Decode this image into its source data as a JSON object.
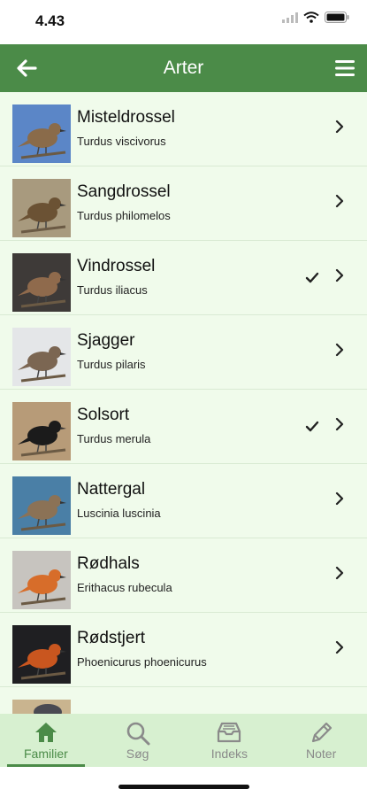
{
  "status": {
    "time": "4.43"
  },
  "header": {
    "title": "Arter"
  },
  "species": [
    {
      "name": "Misteldrossel",
      "latin": "Turdus viscivorus",
      "checked": false,
      "thumb_colors": [
        "#5b86c7",
        "#8a6b4a"
      ]
    },
    {
      "name": "Sangdrossel",
      "latin": "Turdus philomelos",
      "checked": false,
      "thumb_colors": [
        "#a89a7e",
        "#6b5234"
      ]
    },
    {
      "name": "Vindrossel",
      "latin": "Turdus iliacus",
      "checked": true,
      "thumb_colors": [
        "#3e3a38",
        "#8f6a4c"
      ]
    },
    {
      "name": "Sjagger",
      "latin": "Turdus pilaris",
      "checked": false,
      "thumb_colors": [
        "#e4e6e8",
        "#7b6652"
      ]
    },
    {
      "name": "Solsort",
      "latin": "Turdus merula",
      "checked": true,
      "thumb_colors": [
        "#b79b78",
        "#1b1b1b"
      ]
    },
    {
      "name": "Nattergal",
      "latin": "Luscinia luscinia",
      "checked": false,
      "thumb_colors": [
        "#4a7fa6",
        "#8b7256"
      ]
    },
    {
      "name": "Rødhals",
      "latin": "Erithacus rubecula",
      "checked": false,
      "thumb_colors": [
        "#c7c4bf",
        "#d76d2a"
      ]
    },
    {
      "name": "Rødstjert",
      "latin": "Phoenicurus phoenicurus",
      "checked": false,
      "thumb_colors": [
        "#1f1f22",
        "#c9561f"
      ]
    }
  ],
  "tabs": [
    {
      "label": "Familier",
      "icon": "home-icon",
      "active": true
    },
    {
      "label": "Søg",
      "icon": "search-icon",
      "active": false
    },
    {
      "label": "Indeks",
      "icon": "inbox-icon",
      "active": false
    },
    {
      "label": "Noter",
      "icon": "pencil-icon",
      "active": false
    }
  ],
  "colors": {
    "accent": "#4b8b48",
    "list_bg": "#f0fbeb",
    "tabbar_bg": "#d7f0d0"
  }
}
